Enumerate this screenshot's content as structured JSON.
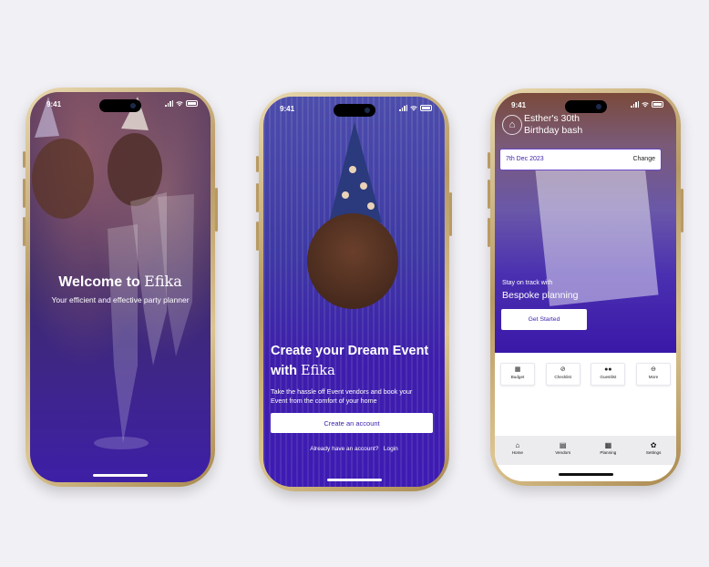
{
  "status_time": "9:41",
  "brand": "Efika",
  "screen1": {
    "welcome_prefix": "Welcome to ",
    "tagline": "Your efficient and effective party planner"
  },
  "screen2": {
    "headline_line1": "Create your Dream Event",
    "headline_prefix": "with ",
    "subtext": "Take the hassle off Event vendors and book your Event from the comfort of your home",
    "create_account": "Create an account",
    "already": "Already have an account?",
    "login": "Login"
  },
  "screen3": {
    "event_title_line1": "Esther's 30th",
    "event_title_line2": "Birthday bash",
    "date": "7th Dec 2023",
    "change": "Change",
    "stay_on_track": "Stay on track with",
    "bespoke": "Bespoke planning",
    "get_started": "Get Started",
    "quick_actions": [
      {
        "label": "Budget",
        "icon": "budget-icon"
      },
      {
        "label": "Checklist",
        "icon": "checklist-icon"
      },
      {
        "label": "Guestlist",
        "icon": "guestlist-icon"
      },
      {
        "label": "More",
        "icon": "more-icon"
      }
    ],
    "tabs": [
      {
        "label": "Home",
        "icon": "home-icon"
      },
      {
        "label": "Vendors",
        "icon": "vendors-icon"
      },
      {
        "label": "Planning",
        "icon": "planning-icon"
      },
      {
        "label": "Settings",
        "icon": "settings-icon"
      }
    ]
  },
  "colors": {
    "background": "#f1f0f4",
    "accent_purple": "#3a18a8",
    "phone_frame_gold": "#c9ad74"
  }
}
